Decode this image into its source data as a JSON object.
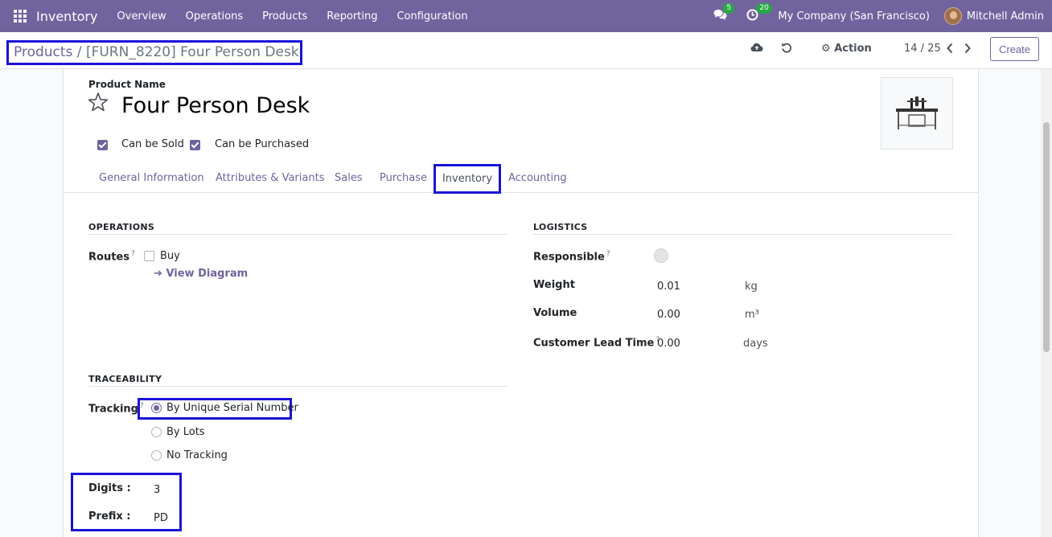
{
  "navbar": {
    "app_title": "Inventory",
    "menu": [
      "Overview",
      "Operations",
      "Products",
      "Reporting",
      "Configuration"
    ],
    "messages_count": "5",
    "activities_count": "20",
    "company": "My Company (San Francisco)",
    "user": "Mitchell Admin"
  },
  "control_panel": {
    "breadcrumb_parent": "Products",
    "breadcrumb_sep": " / ",
    "breadcrumb_current": "[FURN_8220] Four Person Desk",
    "action_label": "Action",
    "pager": "14 / 25",
    "create_label": "Create"
  },
  "form": {
    "product_name_label": "Product Name",
    "product_name": "Four Person Desk",
    "can_be_sold_label": "Can be Sold",
    "can_be_purchased_label": "Can be Purchased",
    "tabs": [
      "General Information",
      "Attributes & Variants",
      "Sales",
      "Purchase",
      "Inventory",
      "Accounting"
    ],
    "operations": {
      "title": "OPERATIONS",
      "routes_label": "Routes",
      "route_buy": "Buy",
      "view_diagram": "View Diagram"
    },
    "logistics": {
      "title": "LOGISTICS",
      "responsible_label": "Responsible",
      "weight_label": "Weight",
      "weight_value": "0.01",
      "weight_unit": "kg",
      "volume_label": "Volume",
      "volume_value": "0.00",
      "volume_unit": "m³",
      "lead_time_label": "Customer Lead Time",
      "lead_time_value": "0.00",
      "lead_time_unit": "days"
    },
    "traceability": {
      "title": "TRACEABILITY",
      "tracking_label": "Tracking",
      "options": [
        "By Unique Serial Number",
        "By Lots",
        "No Tracking"
      ],
      "digits_label": "Digits :",
      "digits_value": "3",
      "prefix_label": "Prefix :",
      "prefix_value": "PD"
    }
  },
  "colors": {
    "brand": "#71639e",
    "highlight": "#1a12d9",
    "badge": "#28a745"
  }
}
